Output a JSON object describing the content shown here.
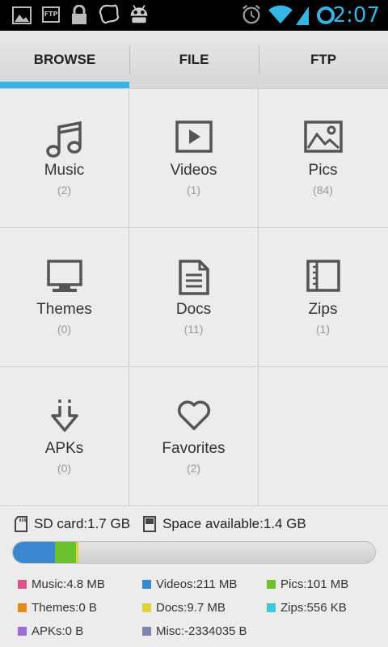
{
  "status_bar": {
    "time": "2:07",
    "icons": [
      "image-icon",
      "ftp-icon",
      "lock-icon",
      "blob-icon",
      "android-icon",
      "alarm-icon",
      "wifi-icon",
      "signal-icon",
      "battery-ring-icon"
    ],
    "ftp_badge": "FTP",
    "accent_color": "#33b5e5"
  },
  "tabs": [
    {
      "label": "BROWSE",
      "active": true
    },
    {
      "label": "FILE",
      "active": false
    },
    {
      "label": "FTP",
      "active": false
    }
  ],
  "categories": [
    {
      "label": "Music",
      "count": "(2)",
      "icon": "music-note-icon"
    },
    {
      "label": "Videos",
      "count": "(1)",
      "icon": "play-icon"
    },
    {
      "label": "Pics",
      "count": "(84)",
      "icon": "picture-icon"
    },
    {
      "label": "Themes",
      "count": "(0)",
      "icon": "monitor-icon"
    },
    {
      "label": "Docs",
      "count": "(11)",
      "icon": "document-icon"
    },
    {
      "label": "Zips",
      "count": "(1)",
      "icon": "archive-icon"
    },
    {
      "label": "APKs",
      "count": "(0)",
      "icon": "download-arrow-icon"
    },
    {
      "label": "Favorites",
      "count": "(2)",
      "icon": "heart-icon"
    }
  ],
  "storage": {
    "sd_card": "SD card:1.7 GB",
    "space_available": "Space available:1.4 GB",
    "usage_segments": [
      {
        "name": "Videos",
        "fraction": 0.117,
        "color": "#3a86cf"
      },
      {
        "name": "Pics",
        "fraction": 0.058,
        "color": "#6cc12e"
      },
      {
        "name": "Docs",
        "fraction": 0.006,
        "color": "#e0d23c"
      }
    ]
  },
  "legend": [
    {
      "label": "Music:4.8 MB",
      "color": "#d8548a"
    },
    {
      "label": "Videos:211 MB",
      "color": "#3a86cf"
    },
    {
      "label": "Pics:101 MB",
      "color": "#6cc12e"
    },
    {
      "label": "Themes:0 B",
      "color": "#e58a1f"
    },
    {
      "label": "Docs:9.7 MB",
      "color": "#e0d23c"
    },
    {
      "label": "Zips:556 KB",
      "color": "#3ec9d6"
    },
    {
      "label": "APKs:0 B",
      "color": "#9b6fd3"
    },
    {
      "label": "Misc:-2334035 B",
      "color": "#7c86a8"
    }
  ]
}
